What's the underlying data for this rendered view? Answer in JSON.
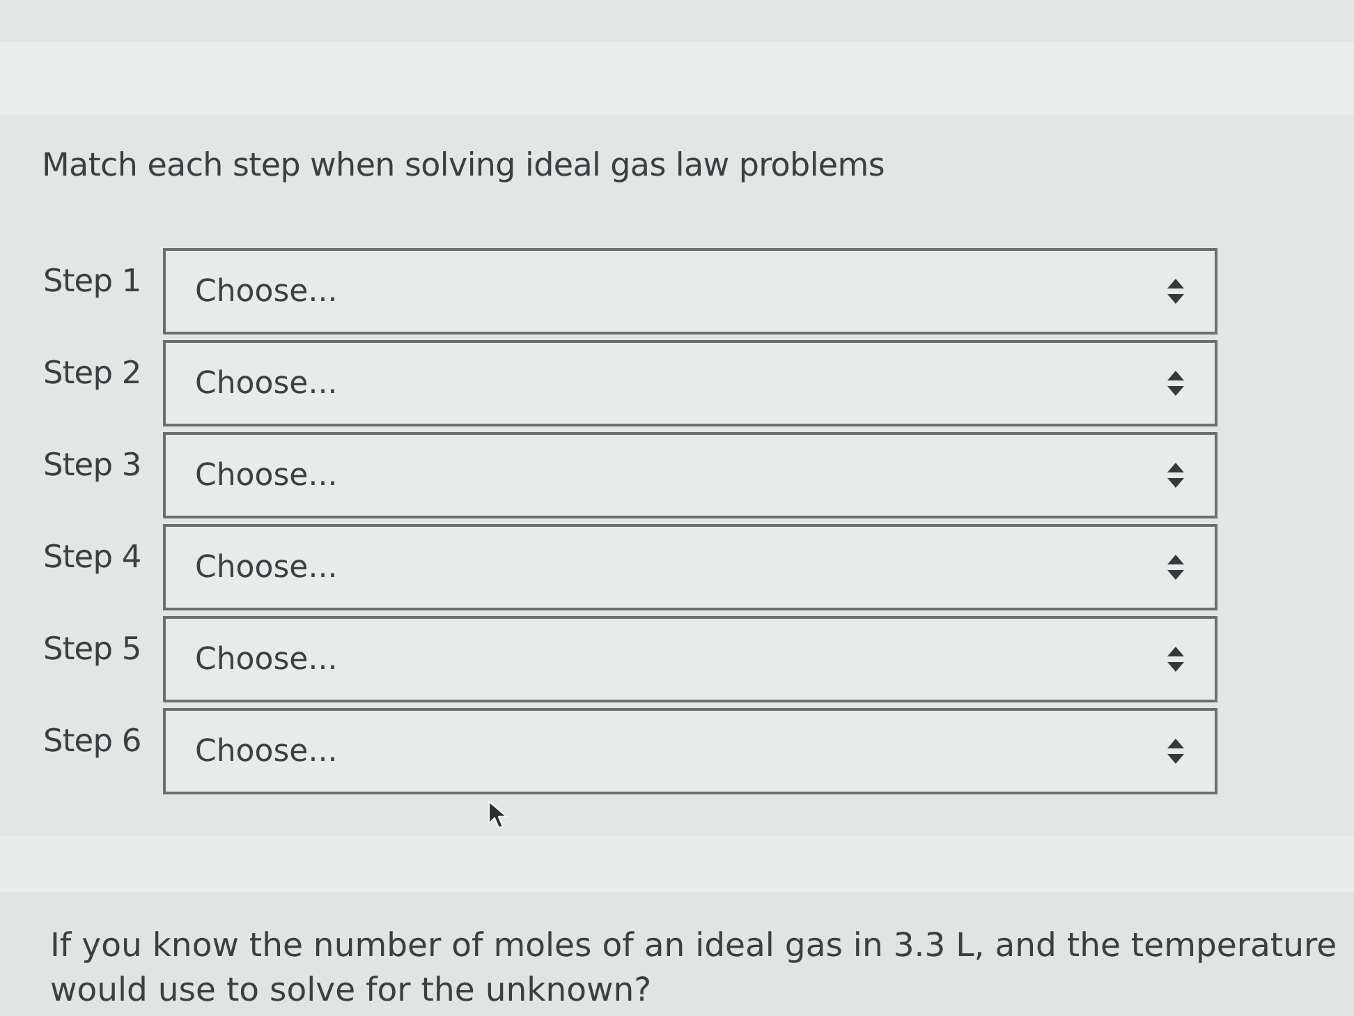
{
  "question_1": {
    "prompt": "Match each step when solving ideal gas law problems",
    "steps": [
      {
        "label": "Step 1",
        "value": "Choose..."
      },
      {
        "label": "Step 2",
        "value": "Choose..."
      },
      {
        "label": "Step 3",
        "value": "Choose..."
      },
      {
        "label": "Step 4",
        "value": "Choose..."
      },
      {
        "label": "Step 5",
        "value": "Choose..."
      },
      {
        "label": "Step 6",
        "value": "Choose..."
      }
    ]
  },
  "question_2": {
    "lines": [
      "If you know the number of moles of an ideal gas in 3.3 L, and the temperature",
      "would use to solve for the unknown?"
    ]
  }
}
